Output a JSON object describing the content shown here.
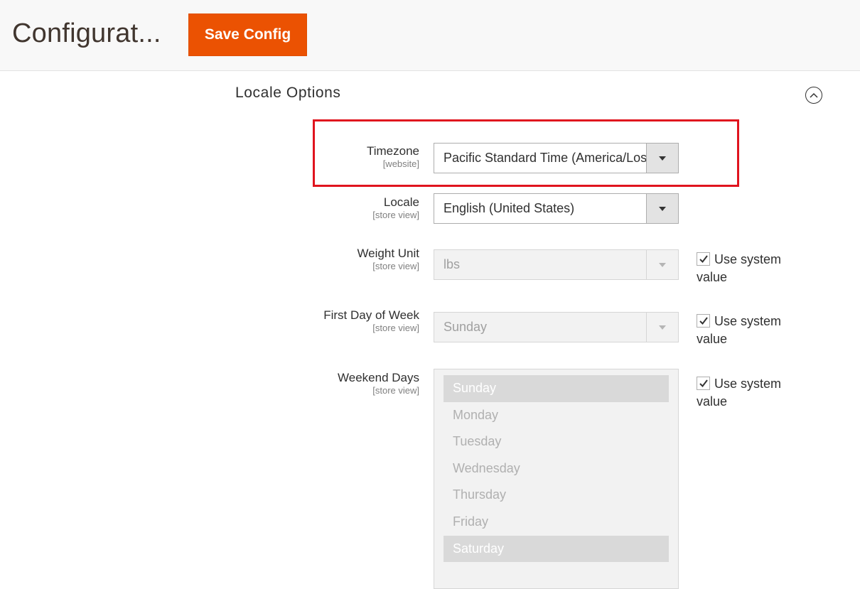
{
  "header": {
    "title": "Configurat...",
    "save_label": "Save Config"
  },
  "section": {
    "title": "Locale Options"
  },
  "fields": {
    "timezone": {
      "label": "Timezone",
      "scope": "[website]",
      "value": "Pacific Standard Time (America/Los_Angeles)"
    },
    "locale": {
      "label": "Locale",
      "scope": "[store view]",
      "value": "English (United States)"
    },
    "weight_unit": {
      "label": "Weight Unit",
      "scope": "[store view]",
      "value": "lbs",
      "use_system": "Use system value"
    },
    "first_day": {
      "label": "First Day of Week",
      "scope": "[store view]",
      "value": "Sunday",
      "use_system": "Use system value"
    },
    "weekend": {
      "label": "Weekend Days",
      "scope": "[store view]",
      "use_system": "Use system value",
      "options": [
        "Sunday",
        "Monday",
        "Tuesday",
        "Wednesday",
        "Thursday",
        "Friday",
        "Saturday"
      ],
      "selected": [
        "Sunday",
        "Saturday"
      ]
    }
  },
  "colors": {
    "accent": "#eb5202",
    "highlight": "#e0141e"
  }
}
